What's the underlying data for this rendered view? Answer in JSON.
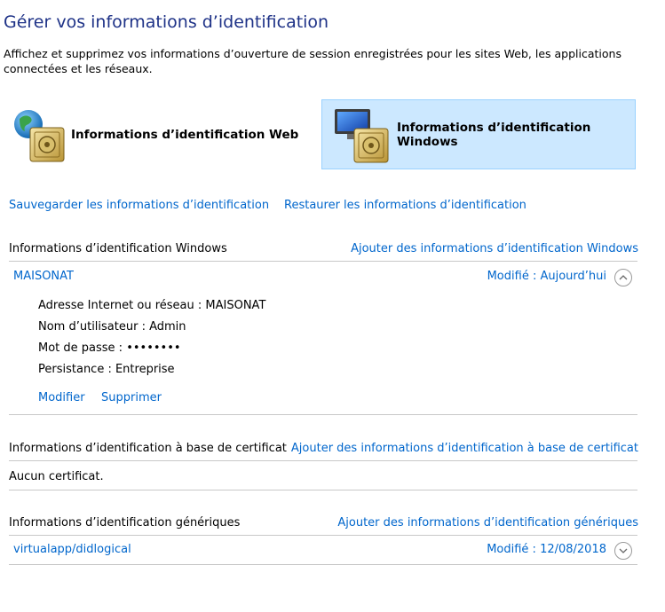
{
  "header": {
    "title": "Gérer vos informations d’identification",
    "description": "Affichez et supprimez vos informations d’ouverture de session enregistrées pour les sites Web, les applications connectées et les réseaux."
  },
  "categories": {
    "web_label": "Informations d’identification Web",
    "windows_label": "Informations d’identification Windows"
  },
  "actions": {
    "backup": "Sauvegarder les informations d’identification",
    "restore": "Restaurer les informations d’identification"
  },
  "windows_section": {
    "heading": "Informations d’identification Windows",
    "add_link": "Ajouter des informations d’identification Windows",
    "entry": {
      "name": "MAISONAT",
      "modified": "Modifié : Aujourd’hui",
      "address": "Adresse Internet ou réseau : MAISONAT",
      "username": "Nom d’utilisateur : Admin",
      "password": "Mot de passe : ••••••••",
      "persistence": "Persistance : Entreprise",
      "edit_link": "Modifier",
      "delete_link": "Supprimer"
    }
  },
  "certificate_section": {
    "heading": "Informations d’identification à base de certificat",
    "add_link": "Ajouter des informations d’identification à base de certificat",
    "empty_text": "Aucun certificat."
  },
  "generic_section": {
    "heading": "Informations d’identification génériques",
    "add_link": "Ajouter des informations d’identification génériques",
    "entry": {
      "name": "virtualapp/didlogical",
      "modified": "Modifié : 12/08/2018"
    }
  },
  "colors": {
    "link": "#0066cc",
    "title": "#1e3287",
    "selected_bg": "#cce8ff",
    "selected_border": "#99d1ff"
  }
}
